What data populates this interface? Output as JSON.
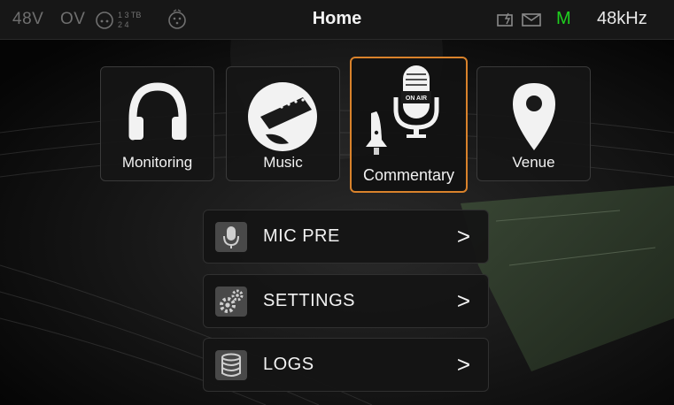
{
  "status_bar": {
    "phantom_power": "48V",
    "overload": "OV",
    "channel_map": {
      "top": "1 3 TB",
      "bottom": "2 4"
    },
    "title": "Home",
    "monitor_indicator": "M",
    "sample_rate": "48kHz",
    "icons": [
      "headset-icon",
      "xlr-connector-icon",
      "network-icon",
      "mail-icon"
    ]
  },
  "scenes": [
    {
      "label": "Monitoring",
      "icon": "headphones-icon",
      "active": false
    },
    {
      "label": "Music",
      "icon": "guitar-icon",
      "active": false
    },
    {
      "label": "Commentary",
      "icon": "on-air-microphone-icon",
      "badge": "ON AIR",
      "active": true
    },
    {
      "label": "Venue",
      "icon": "location-pin-icon",
      "active": false
    }
  ],
  "menu": [
    {
      "label": "MIC PRE",
      "icon": "microphone-icon",
      "arrow": ">"
    },
    {
      "label": "SETTINGS",
      "icon": "gears-icon",
      "arrow": ">"
    },
    {
      "label": "LOGS",
      "icon": "database-icon",
      "arrow": ">"
    }
  ],
  "colors": {
    "active_border": "#d9822b",
    "monitor_green": "#1fd01f",
    "status_bar_bg": "#171717",
    "tile_bg": "#161616"
  }
}
